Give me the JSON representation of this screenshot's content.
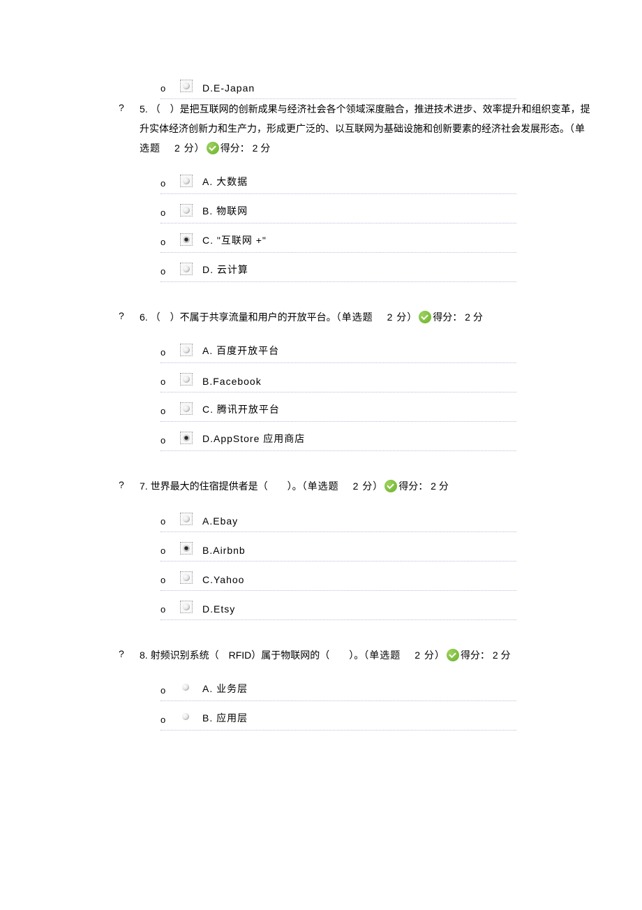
{
  "fragment_option": {
    "bullet": "o",
    "label": "D.E-Japan"
  },
  "common": {
    "question_bullet": "?",
    "option_bullet": "o",
    "type_label": "（单选题",
    "points_suffix": "分）",
    "score_prefix": "得分：",
    "score_suffix": "分"
  },
  "questions": [
    {
      "number": "5.",
      "text_pre": "（　）是把互联网的创新成果与经济社会各个领域深度融合，推进技术进步、效率提升和组织变革，提升实体经济创新力和生产力，形成更广泛的、以互联网为基础设施和创新要素的经济社会发展形态。",
      "points": "2",
      "score": "2",
      "options": [
        {
          "label": "A. 大数据",
          "selected": false
        },
        {
          "label": "B. 物联网",
          "selected": false
        },
        {
          "label": "C. \"互联网 +\"",
          "selected": true
        },
        {
          "label": "D. 云计算",
          "selected": false
        }
      ]
    },
    {
      "number": "6.",
      "text_pre": "（　）不属于共享流量和用户的开放平台。",
      "points": "2",
      "score": "2",
      "options": [
        {
          "label": "A. 百度开放平台",
          "selected": false
        },
        {
          "label": "B.Facebook",
          "selected": false
        },
        {
          "label": "C. 腾讯开放平台",
          "selected": false
        },
        {
          "label": "D.AppStore  应用商店",
          "selected": true
        }
      ]
    },
    {
      "number": "7.",
      "text_pre": "世界最大的住宿提供者是（　　）。",
      "points": "2",
      "score": "2",
      "options": [
        {
          "label": "A.Ebay",
          "selected": false
        },
        {
          "label": "B.Airbnb",
          "selected": true
        },
        {
          "label": "C.Yahoo",
          "selected": false
        },
        {
          "label": "D.Etsy",
          "selected": false
        }
      ]
    },
    {
      "number": "8.",
      "text_pre": "射频识别系统（　RFID）属于物联网的（　　）。",
      "points": "2",
      "score": "2",
      "options": [
        {
          "label": "A. 业务层",
          "selected": false,
          "noborder": true
        },
        {
          "label": "B. 应用层",
          "selected": false,
          "noborder": true
        }
      ]
    }
  ]
}
